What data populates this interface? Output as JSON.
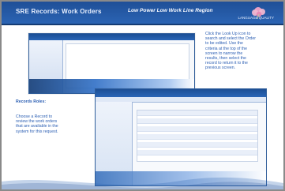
{
  "slide": {
    "header": {
      "title": "SRE Records: Work Orders",
      "subtitle": "Low Power Low Work Line Region",
      "logo_text": "LANGUAGE QUALITY"
    },
    "notes": {
      "right_text": "Click the Look Up icon to\nsearch and select the Order\nto be edited. Use the\ncriteria at the top of the\nscreen to narrow the\nresults, then select the\nrecord to return it to the\nprevious screen.",
      "left_title": "Records Roles:",
      "left_text": "Choose a Record to\nreview the work orders\nthat are available in the\nsystem for this request."
    },
    "colors": {
      "accent": "#2b64b3",
      "header_dark": "#1f4f97",
      "note_blue": "#2c5fb3"
    },
    "icons": {
      "logo": "flower-logo-icon"
    }
  }
}
